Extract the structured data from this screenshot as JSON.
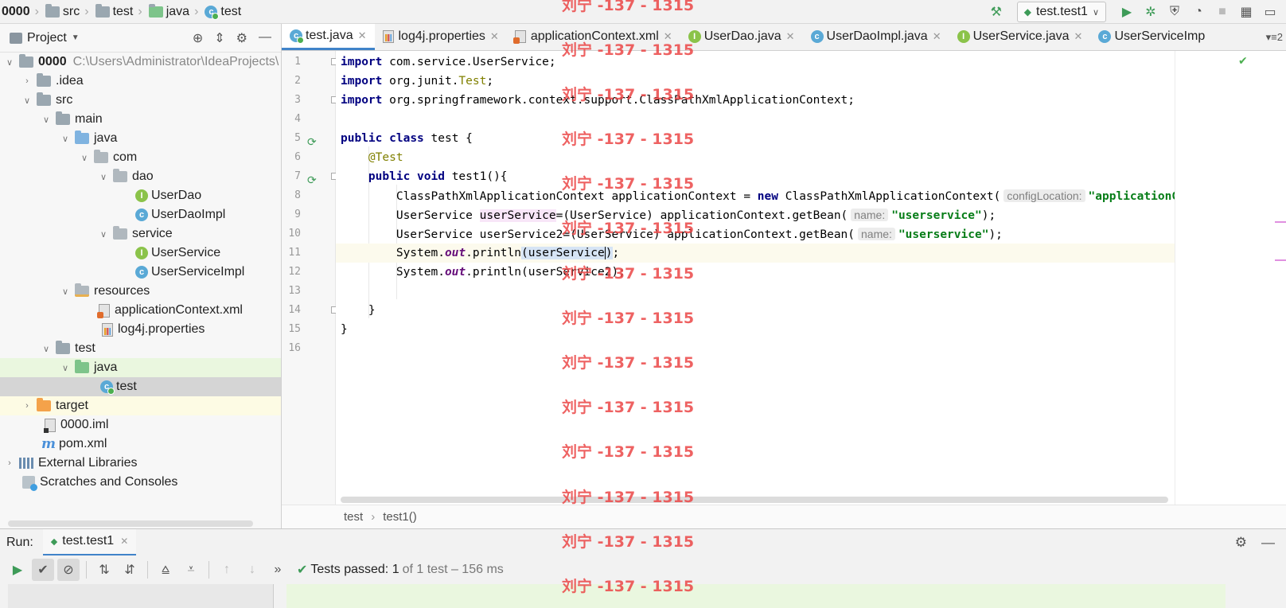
{
  "navbar": {
    "crumbs": [
      "0000",
      "src",
      "test",
      "java",
      "test"
    ]
  },
  "run_config": {
    "label": "test.test1"
  },
  "project": {
    "title": "Project",
    "tree": {
      "root": "0000",
      "root_path": "C:\\Users\\Administrator\\IdeaProjects\\",
      "idea": ".idea",
      "src": "src",
      "main": "main",
      "java_main": "java",
      "com": "com",
      "dao": "dao",
      "userdao": "UserDao",
      "userdaoimpl": "UserDaoImpl",
      "service": "service",
      "userservice": "UserService",
      "userserviceimpl": "UserServiceImpl",
      "resources": "resources",
      "appctx": "applicationContext.xml",
      "log4j": "log4j.properties",
      "test": "test",
      "java_test": "java",
      "test_class": "test",
      "target": "target",
      "iml": "0000.iml",
      "pom": "pom.xml",
      "external_libs": "External Libraries",
      "scratches": "Scratches and Consoles"
    }
  },
  "editor": {
    "tabs": [
      "test.java",
      "log4j.properties",
      "applicationContext.xml",
      "UserDao.java",
      "UserDaoImpl.java",
      "UserService.java",
      "UserServiceImp"
    ],
    "tab_overflow": "▾≡2",
    "line_numbers": [
      "1",
      "2",
      "3",
      "4",
      "5",
      "6",
      "7",
      "8",
      "9",
      "10",
      "11",
      "12",
      "13",
      "14",
      "15",
      "16"
    ],
    "code": {
      "l1_kw": "import",
      "l1_rest": " com.service.UserService;",
      "l2_kw": "import",
      "l2_a": " org.junit.",
      "l2_ann": "Test",
      "l2_b": ";",
      "l3_kw": "import",
      "l3_rest": " org.springframework.context.support.ClassPathXmlApplicationContext;",
      "l5_kw1": "public",
      "l5_kw2": "class",
      "l5_rest": " test {",
      "l6_ann": "@Test",
      "l7_kw1": "public",
      "l7_kw2": "void",
      "l7_rest": " test1(){",
      "l8_a": "ClassPathXmlApplicationContext applicationContext = ",
      "l8_kw": "new",
      "l8_b": " ClassPathXmlApplicationContext(",
      "l8_hint": "configLocation:",
      "l8_str": "\"applicationContext.xml\"",
      "l9_a": "UserService ",
      "l9_var": "userService",
      "l9_b": "=(UserService) applicationContext.getBean(",
      "l9_hint": "name:",
      "l9_str": "\"userservice\"",
      "l9_c": ");",
      "l10_a": "UserService userService2=(UserService) applicationContext.getBean(",
      "l10_hint": "name:",
      "l10_str": "\"userservice\"",
      "l10_c": ");",
      "l11_a": "System.",
      "l11_fld": "out",
      "l11_b": ".println",
      "l11_paren": "(",
      "l11_var": "userService",
      "l11_close": ")",
      "l11_c": ";",
      "l12_a": "System.",
      "l12_fld": "out",
      "l12_b": ".println(userService2);",
      "l14": "}",
      "l15": "}"
    },
    "breadcrumb": [
      "test",
      "test1()"
    ]
  },
  "run": {
    "label": "Run:",
    "tab": "test.test1",
    "status_prefix": "Tests passed:",
    "status_count": "1",
    "status_detail": "of 1 test – 156 ms"
  },
  "watermark": {
    "text": "刘宁 -137 - 1315"
  },
  "colors": {
    "accent": "#4083c9",
    "pass": "#3e9b58",
    "watermark": "#eb4646"
  }
}
